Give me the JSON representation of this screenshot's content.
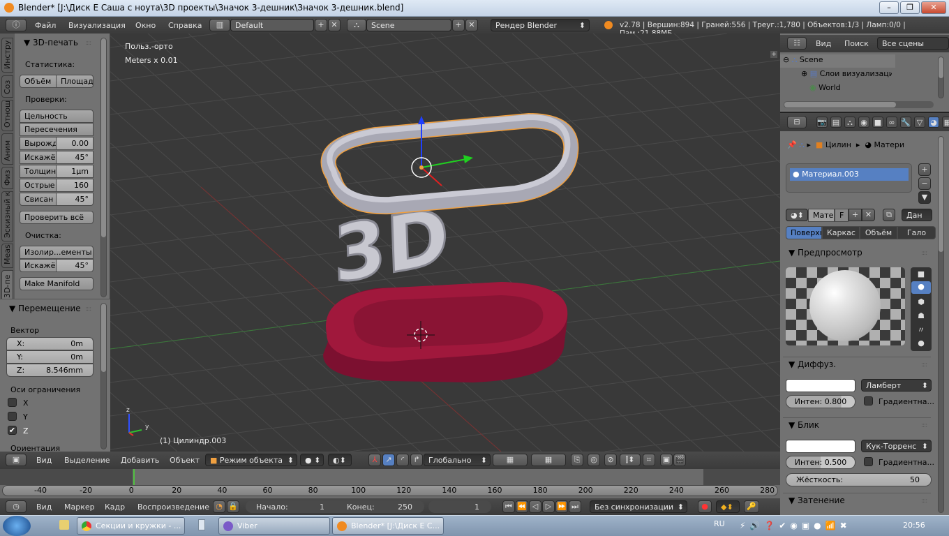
{
  "window": {
    "title": "Blender* [J:\\Диск E Саша с ноута\\3D проекты\\Значок 3-дешник\\Значок 3-дешник.blend]",
    "controls": [
      "minimize",
      "maximize",
      "close"
    ]
  },
  "info_header": {
    "menus": [
      "Файл",
      "Визуализация",
      "Окно",
      "Справка"
    ],
    "layout": "Default",
    "scene": "Scene",
    "engine": "Рендер Blender",
    "stats": "v2.78 | Вершин:894 | Граней:556 | Треуг.:1,780 | Объектов:1/3 | Ламп:0/0 | Пам.:21.88МБ"
  },
  "toolshelf": {
    "tabs": [
      "Инстру",
      "Соз",
      "Отнош",
      "Аним",
      "Физ",
      "Эскизный к",
      "Meas",
      "3D-пе"
    ],
    "panel_title": "3D-печать",
    "stats_label": "Статистика:",
    "volume_btn": "Объём",
    "area_btn": "Площад",
    "checks_label": "Проверки:",
    "solid_btn": "Цельность",
    "intersect_btn": "Пересечения",
    "fields": [
      {
        "label": "Вырожд",
        "value": "0.00"
      },
      {
        "label": "Искажё",
        "value": "45°"
      },
      {
        "label": "Толщин",
        "value": "1µm"
      },
      {
        "label": "Острые",
        "value": "160"
      },
      {
        "label": "Свисан",
        "value": "45°"
      }
    ],
    "check_all_btn": "Проверить всё",
    "cleanup_label": "Очистка:",
    "isolated_btn": "Изолир...ементы",
    "distort_label": "Искажё",
    "distort_value": "45°",
    "make_manifold_btn": "Make Manifold"
  },
  "operator": {
    "title": "Перемещение",
    "vector_label": "Вектор",
    "x": {
      "label": "X:",
      "value": "0m"
    },
    "y": {
      "label": "Y:",
      "value": "0m"
    },
    "z": {
      "label": "Z:",
      "value": "8.546mm"
    },
    "constraint_label": "Оси ограничения",
    "axes": [
      {
        "label": "X",
        "checked": false
      },
      {
        "label": "Y",
        "checked": false
      },
      {
        "label": "Z",
        "checked": true
      }
    ],
    "orientation_label": "Ориентация"
  },
  "viewport": {
    "view_name": "Польз.-орто",
    "units": "Meters x 0.01",
    "object_info": "(1) Цилиндр.003",
    "model_text": "3D",
    "colors": {
      "background": "#393939",
      "selected_outline": "#f0a040",
      "base": "#a0183c",
      "ring": "#b8b8c4"
    }
  },
  "view3d_header": {
    "menus": [
      "Вид",
      "Выделение",
      "Добавить",
      "Объект"
    ],
    "mode": "Режим объекта",
    "orientation": "Глобально"
  },
  "timeline": {
    "ticks": [
      "-40",
      "-20",
      "0",
      "20",
      "40",
      "60",
      "80",
      "100",
      "120",
      "140",
      "160",
      "180",
      "200",
      "220",
      "240",
      "260",
      "280"
    ],
    "current_frame": 0,
    "menus": [
      "Вид",
      "Маркер",
      "Кадр",
      "Воспроизведение"
    ],
    "start_label": "Начало:",
    "start": "1",
    "end_label": "Конец:",
    "end": "250",
    "frame": "1",
    "sync": "Без синхронизации"
  },
  "outliner": {
    "menus": [
      "Вид",
      "Поиск"
    ],
    "filter": "Все сцены",
    "items": [
      {
        "label": "Scene"
      },
      {
        "label": "Слои визуализации"
      },
      {
        "label": "World"
      }
    ]
  },
  "properties": {
    "breadcrumb": [
      "Цилин",
      "Матери"
    ],
    "material": "Материал.003",
    "mat_field": "Мате",
    "fake_user": "F",
    "data_dd": "Дан",
    "tabs": [
      "Поверхн",
      "Каркас",
      "Объём",
      "Гало"
    ],
    "preview_title": "Предпросмотр",
    "diffuse": {
      "title": "Диффуз.",
      "shader": "Ламберт",
      "intensity": "Интен: 0.800",
      "intensity_value": 0.8,
      "ramp": "Градиентна..."
    },
    "specular": {
      "title": "Блик",
      "shader": "Кук-Торренс",
      "intensity": "Интен: 0.500",
      "intensity_value": 0.5,
      "ramp": "Градиентна...",
      "hardness_label": "Жёсткость:",
      "hardness": "50"
    },
    "shading_title": "Затенение"
  },
  "taskbar": {
    "tasks": [
      "Секции и кружки - ...",
      "Viber",
      "Blender* [J:\\Диск E С..."
    ],
    "lang": "RU",
    "clock": "20:56"
  }
}
